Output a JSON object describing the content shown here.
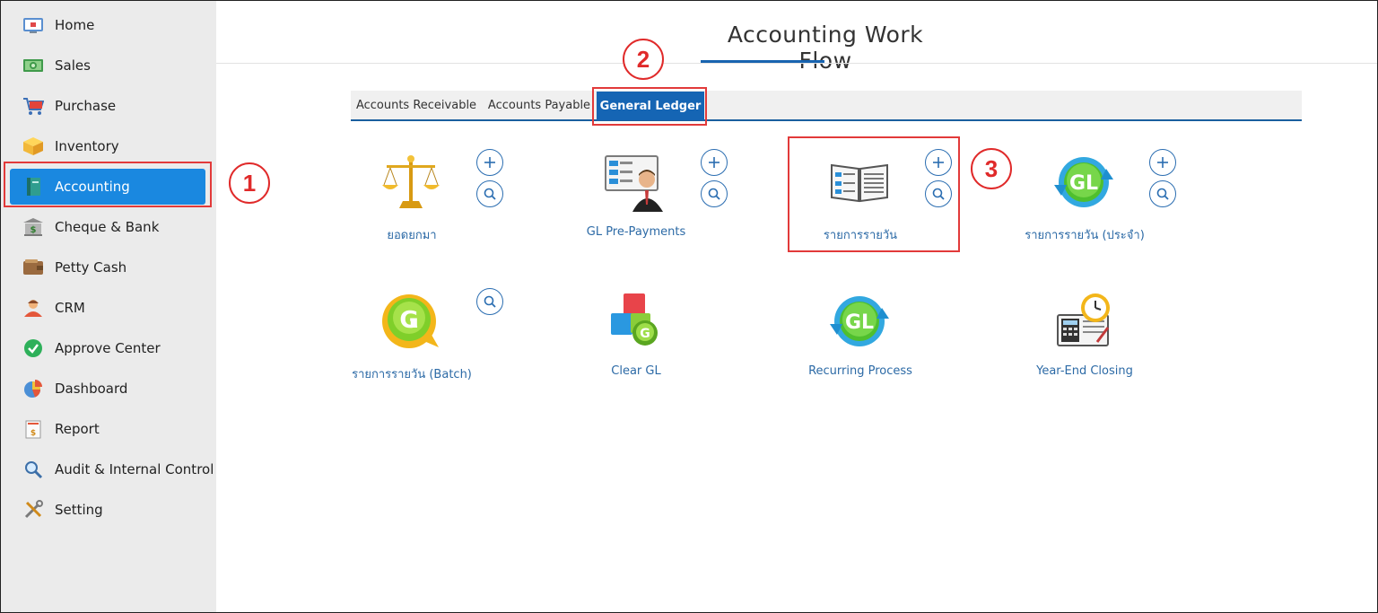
{
  "sidebar": {
    "items": [
      {
        "label": "Home",
        "icon": "home-icon"
      },
      {
        "label": "Sales",
        "icon": "money-icon"
      },
      {
        "label": "Purchase",
        "icon": "cart-icon"
      },
      {
        "label": "Inventory",
        "icon": "box-icon"
      },
      {
        "label": "Accounting",
        "icon": "ledger-book-icon"
      },
      {
        "label": "Cheque & Bank",
        "icon": "bank-icon"
      },
      {
        "label": "Petty Cash",
        "icon": "wallet-icon"
      },
      {
        "label": "CRM",
        "icon": "person-icon"
      },
      {
        "label": "Approve Center",
        "icon": "check-circle-icon"
      },
      {
        "label": "Dashboard",
        "icon": "pie-chart-icon"
      },
      {
        "label": "Report",
        "icon": "report-icon"
      },
      {
        "label": "Audit & Internal Control",
        "icon": "magnifier-icon"
      },
      {
        "label": "Setting",
        "icon": "tools-icon"
      }
    ],
    "active": "Accounting"
  },
  "main": {
    "title": "Accounting Work Flow",
    "tabs": [
      {
        "label": "Accounts Receivable"
      },
      {
        "label": "Accounts Payable"
      },
      {
        "label": "General Ledger"
      }
    ],
    "active_tab": "General Ledger",
    "tiles": [
      {
        "label": "ยอดยกมา",
        "icon": "scales-icon",
        "add": true,
        "search": true
      },
      {
        "label": "GL Pre-Payments",
        "icon": "document-person-icon",
        "add": true,
        "search": true
      },
      {
        "label": "รายการรายวัน",
        "icon": "open-book-icon",
        "add": true,
        "search": true
      },
      {
        "label": "รายการรายวัน (ประจำ)",
        "icon": "gl-recurring-icon",
        "add": true,
        "search": true
      },
      {
        "label": "รายการรายวัน (Batch)",
        "icon": "gl-batch-icon",
        "add": false,
        "search": true
      },
      {
        "label": "Clear GL",
        "icon": "clear-gl-icon",
        "add": false,
        "search": false
      },
      {
        "label": "Recurring Process",
        "icon": "gl-cycle-icon",
        "add": false,
        "search": false
      },
      {
        "label": "Year-End Closing",
        "icon": "calendar-clock-icon",
        "add": false,
        "search": false
      }
    ]
  },
  "annotations": {
    "callout_1": "1",
    "callout_2": "2",
    "callout_3": "3"
  },
  "colors": {
    "accent": "#1a88e0",
    "tab_active": "#1565b4",
    "link": "#2c6aa6",
    "highlight": "#e23a3a"
  }
}
